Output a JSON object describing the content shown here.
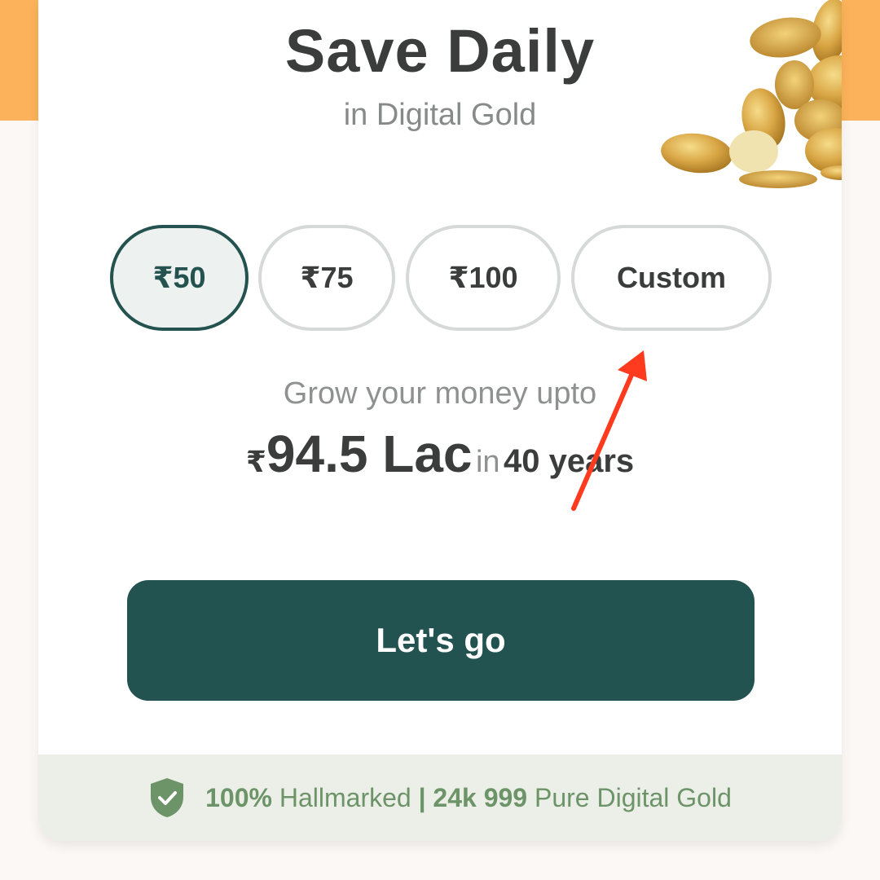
{
  "header": {
    "title": "Save Daily",
    "subtitle": "in Digital Gold"
  },
  "amount_options": [
    {
      "label": "₹50",
      "selected": true
    },
    {
      "label": "₹75",
      "selected": false
    },
    {
      "label": "₹100",
      "selected": false
    },
    {
      "label": "Custom",
      "selected": false
    }
  ],
  "projection": {
    "intro": "Grow your money upto",
    "currency": "₹",
    "amount": "94.5 Lac",
    "in_word": "in",
    "duration": "40 years"
  },
  "cta": {
    "label": "Let's go"
  },
  "footer": {
    "part1_bold": "100%",
    "part1": "Hallmarked",
    "separator": "|",
    "part2_bold": "24k 999",
    "part2": "Pure Digital Gold"
  },
  "colors": {
    "brand": "#23524f",
    "accent_orange": "#fcb25a",
    "annotation_arrow": "#ff3b1f",
    "footer_text": "#6d9468"
  },
  "icons": [
    "gold-coins-illustration",
    "shield-check-icon",
    "annotation-arrow"
  ]
}
